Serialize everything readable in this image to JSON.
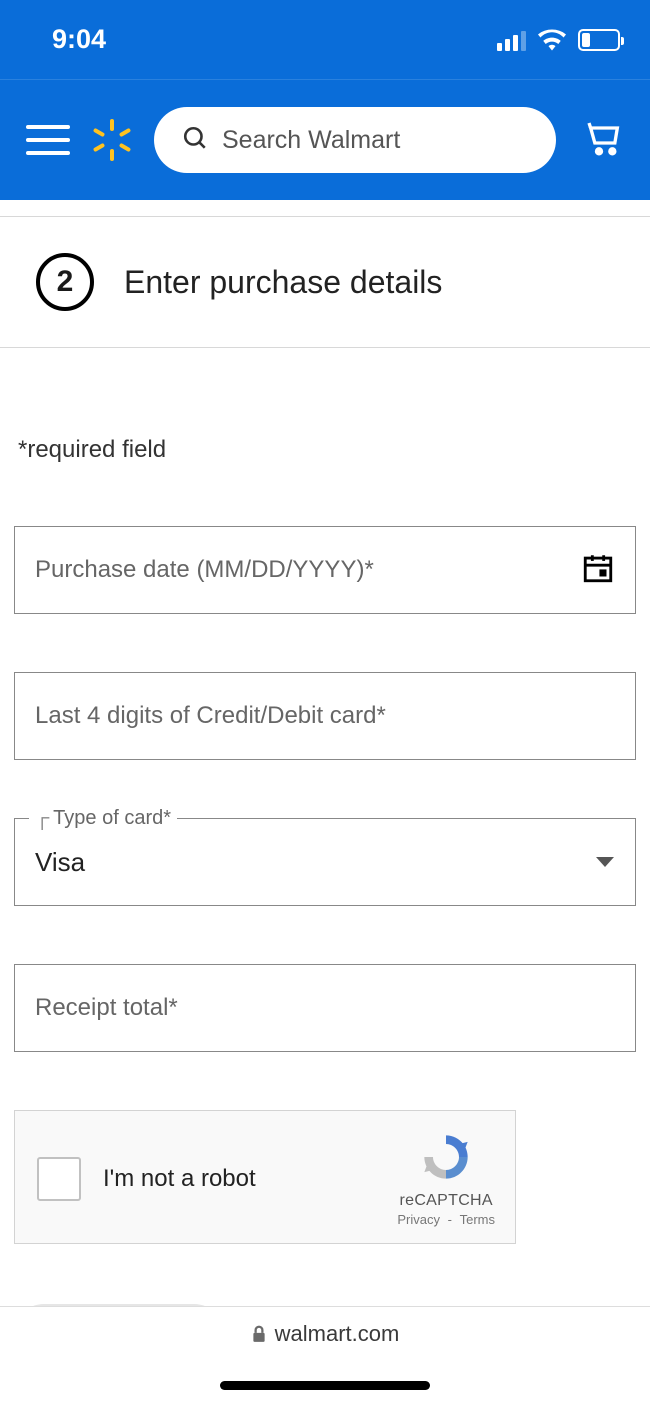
{
  "statusbar": {
    "time": "9:04"
  },
  "header": {
    "search_placeholder": "Search Walmart"
  },
  "step": {
    "number": "2",
    "title": "Enter purchase details"
  },
  "form": {
    "required_note": "*required field",
    "purchase_date_placeholder": "Purchase date (MM/DD/YYYY)*",
    "last4_placeholder": "Last 4 digits of Credit/Debit card*",
    "card_type_label": "Type of card*",
    "card_type_value": "Visa",
    "receipt_total_placeholder": "Receipt total*"
  },
  "recaptcha": {
    "label": "I'm not a robot",
    "name": "reCAPTCHA",
    "privacy": "Privacy",
    "terms": "Terms"
  },
  "browser": {
    "domain": "walmart.com"
  }
}
